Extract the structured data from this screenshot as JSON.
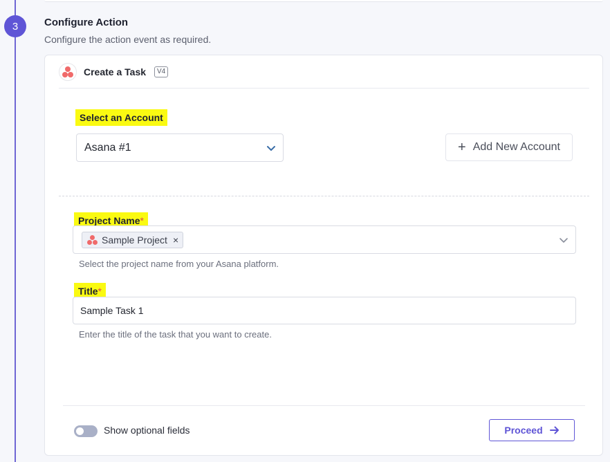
{
  "step": {
    "number": "3",
    "title": "Configure Action",
    "description": "Configure the action event as required."
  },
  "action": {
    "app_icon": "asana-logo",
    "title": "Create a Task",
    "version": "V4"
  },
  "account": {
    "label": "Select an Account",
    "selected": "Asana #1",
    "add_button": "Add New Account"
  },
  "project": {
    "label": "Project Name",
    "required_mark": "*",
    "chip": "Sample Project",
    "remove_icon": "×",
    "help": "Select the project name from your Asana platform."
  },
  "title_field": {
    "label": "Title",
    "required_mark": "*",
    "value": "Sample Task 1",
    "help": "Enter the title of the task that you want to create."
  },
  "footer": {
    "toggle_label": "Show optional fields",
    "toggle_on": false,
    "proceed_button": "Proceed"
  },
  "colors": {
    "accent": "#5f55d6",
    "highlight": "#fafa12",
    "asana": "#f06a6a"
  }
}
